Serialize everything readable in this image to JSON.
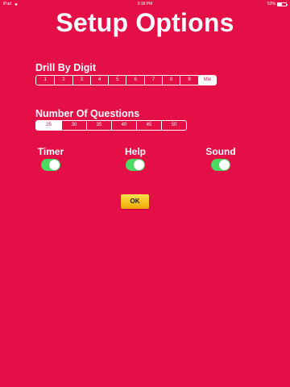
{
  "status_bar": {
    "device": "iPad",
    "time": "5:18 PM",
    "battery_percent_text": "52%",
    "battery_level": 0.52
  },
  "title": "Setup Options",
  "drill_by_digit": {
    "label": "Drill By Digit",
    "options": [
      "1",
      "2",
      "3",
      "4",
      "5",
      "6",
      "7",
      "8",
      "9",
      "Mix"
    ],
    "selected": "Mix"
  },
  "number_of_questions": {
    "label": "Number Of Questions",
    "options": [
      "25",
      "30",
      "35",
      "40",
      "45",
      "50"
    ],
    "selected": "25"
  },
  "toggles": {
    "timer": {
      "label": "Timer",
      "on": true
    },
    "help": {
      "label": "Help",
      "on": true
    },
    "sound": {
      "label": "Sound",
      "on": true
    }
  },
  "ok_button": {
    "label": "OK"
  },
  "colors": {
    "background": "#E50F47",
    "switch_on": "#4CD964",
    "button": "#F8C31C"
  }
}
